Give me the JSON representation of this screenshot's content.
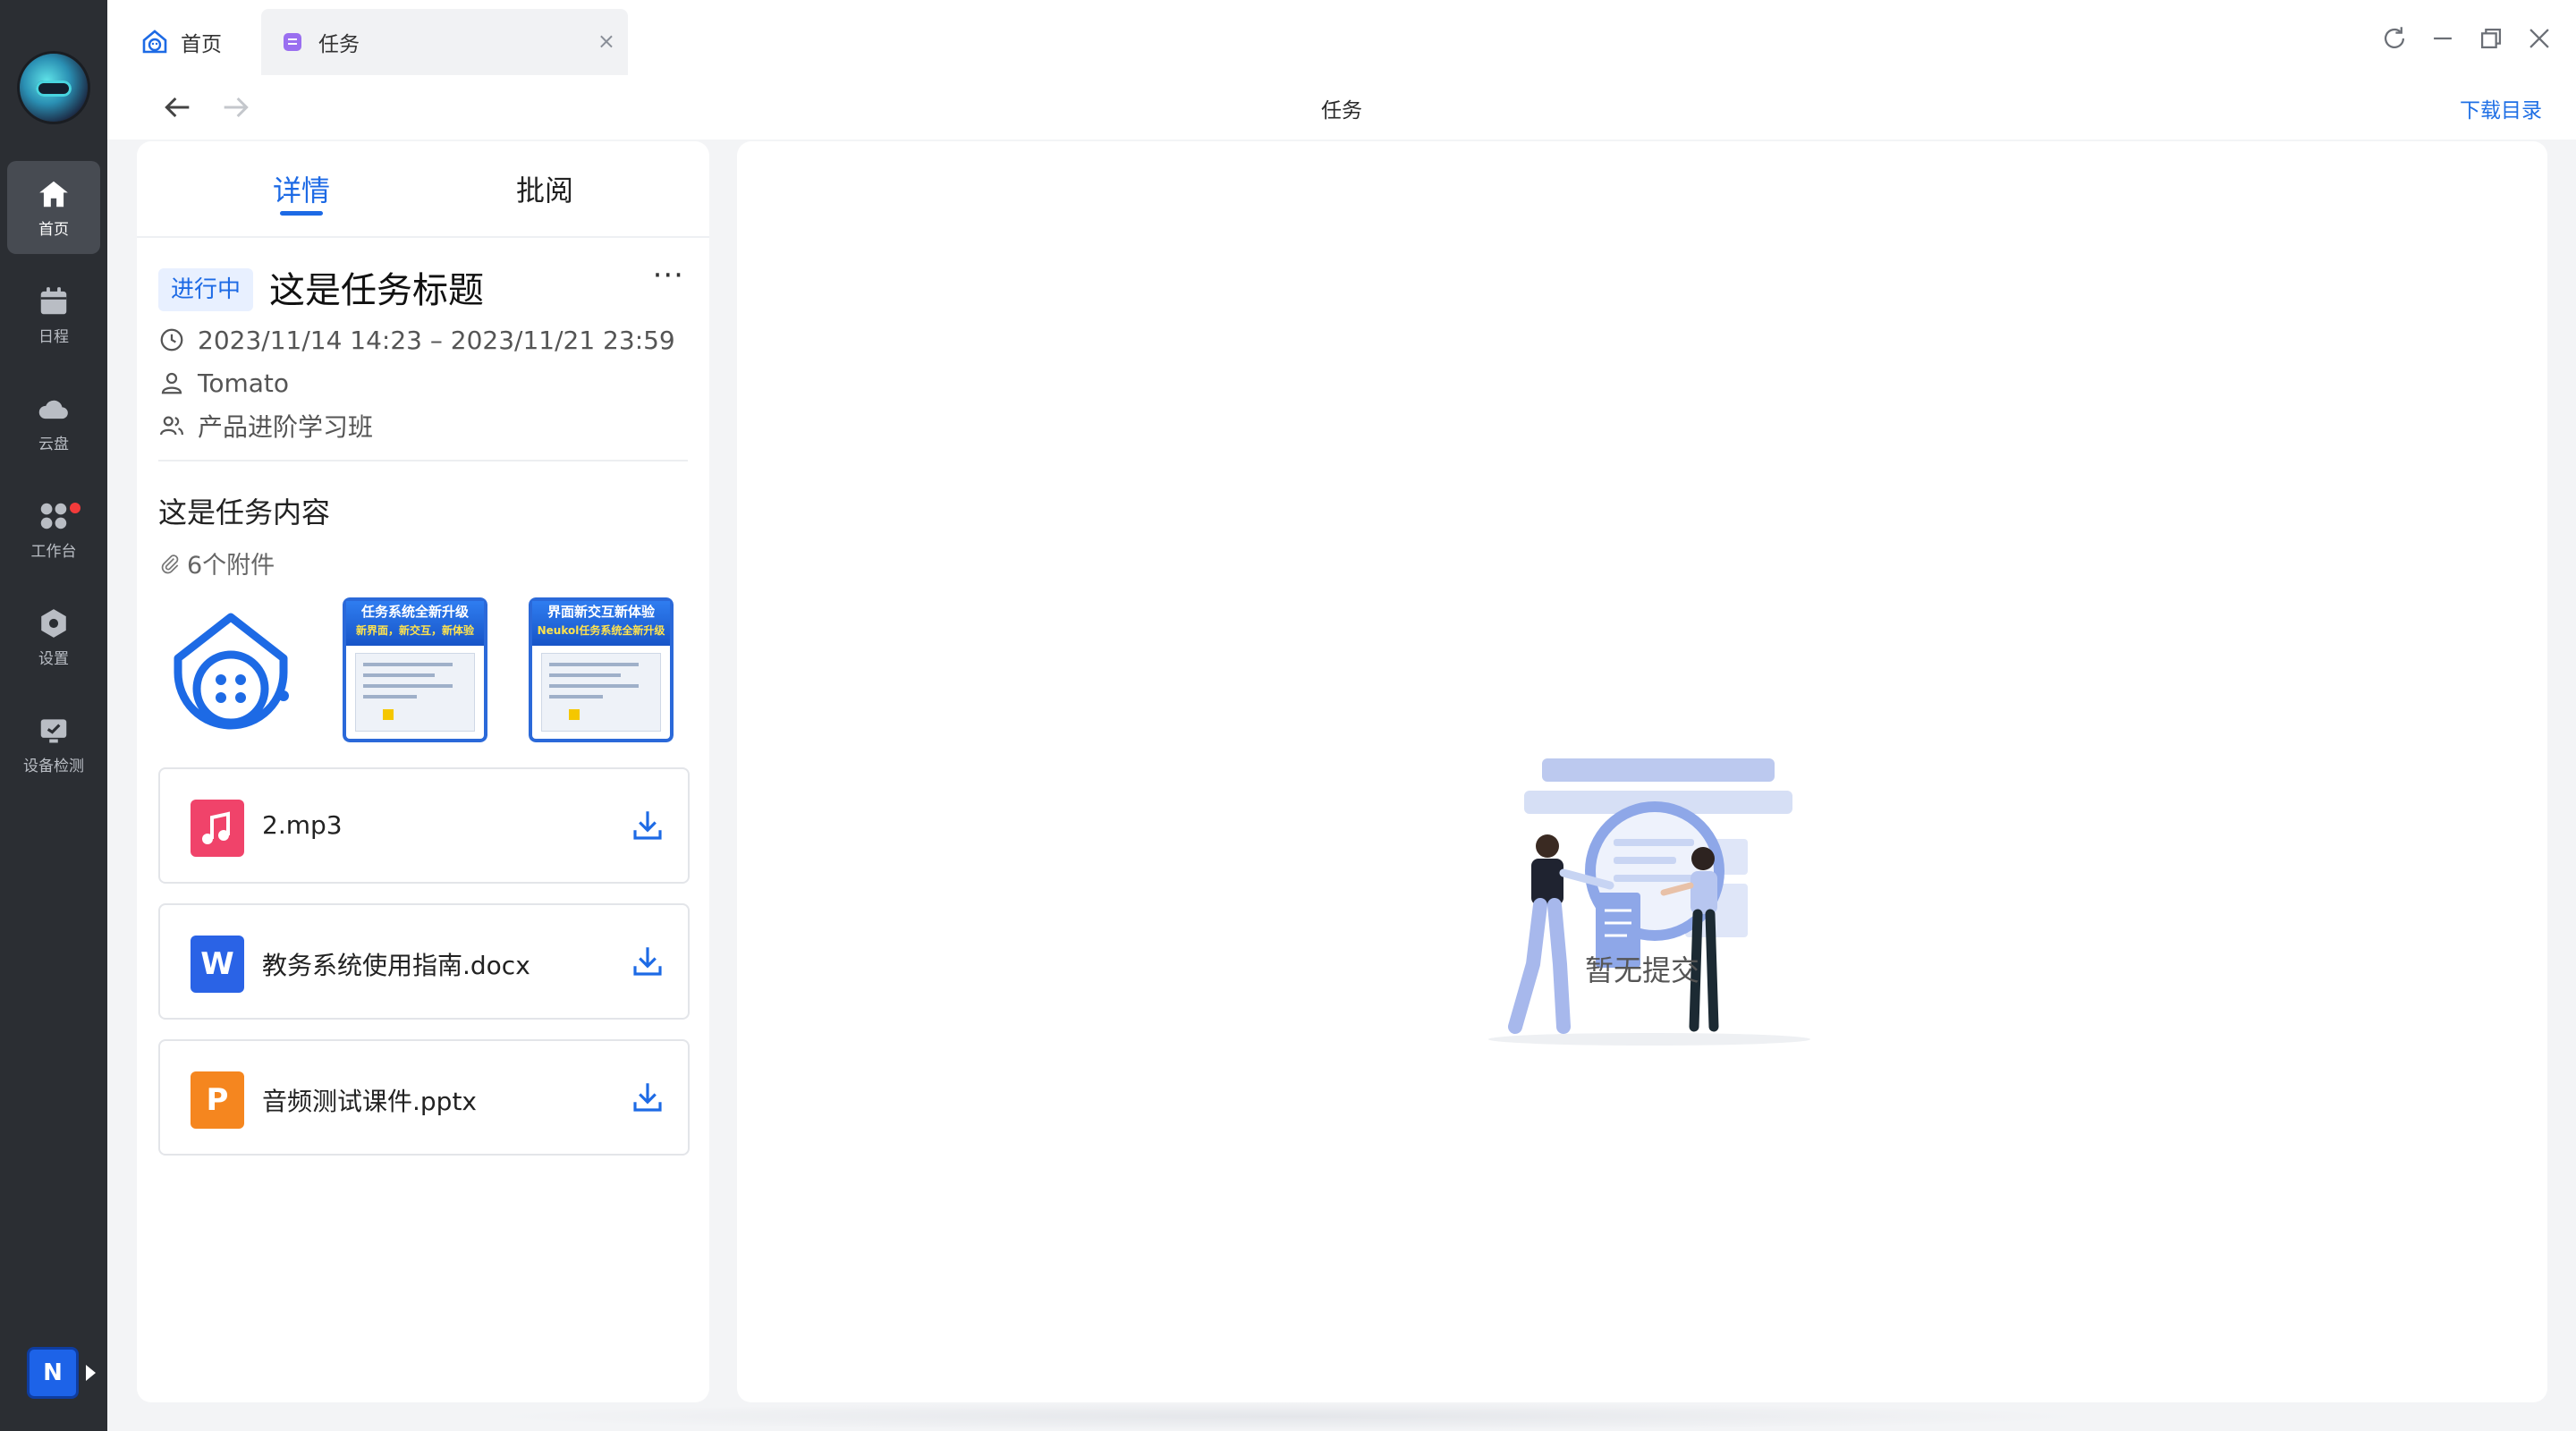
{
  "sidebar": {
    "items": [
      {
        "label": "首页",
        "icon": "home-icon"
      },
      {
        "label": "日程",
        "icon": "calendar-icon"
      },
      {
        "label": "云盘",
        "icon": "cloud-icon"
      },
      {
        "label": "工作台",
        "icon": "apps-icon"
      },
      {
        "label": "设置",
        "icon": "settings-icon"
      },
      {
        "label": "设备检测",
        "icon": "device-check-icon"
      }
    ],
    "bottom_badge": "N"
  },
  "tabs": {
    "home_label": "首页",
    "task_label": "任务",
    "close_symbol": "×"
  },
  "navrow": {
    "title": "任务",
    "download_dir": "下载目录"
  },
  "detail": {
    "tab_detail": "详情",
    "tab_review": "批阅",
    "status": "进行中",
    "title": "这是任务标题",
    "more": "···",
    "time_range": "2023/11/14 14:23 – 2023/11/21 23:59",
    "owner": "Tomato",
    "group": "产品进阶学习班",
    "content": "这是任务内容",
    "attachment_count": "6个附件",
    "thumbs": [
      {
        "head": "任务系统全新升级",
        "sub": "新界面，新交互，新体验"
      },
      {
        "head": "界面新交互新体验",
        "sub": "Neukol任务系统全新升级"
      }
    ],
    "files": [
      {
        "name": "2.mp3",
        "type": "audio",
        "color": "#f0436a"
      },
      {
        "name": "教务系统使用指南.docx",
        "type": "word",
        "color": "#2a63e6"
      },
      {
        "name": "音频测试课件.pptx",
        "type": "ppt",
        "color": "#f5861f"
      }
    ]
  },
  "review": {
    "empty_text": "暂无提交"
  },
  "colors": {
    "accent": "#1d6ae5",
    "sidebar_bg": "#2b2e33"
  }
}
